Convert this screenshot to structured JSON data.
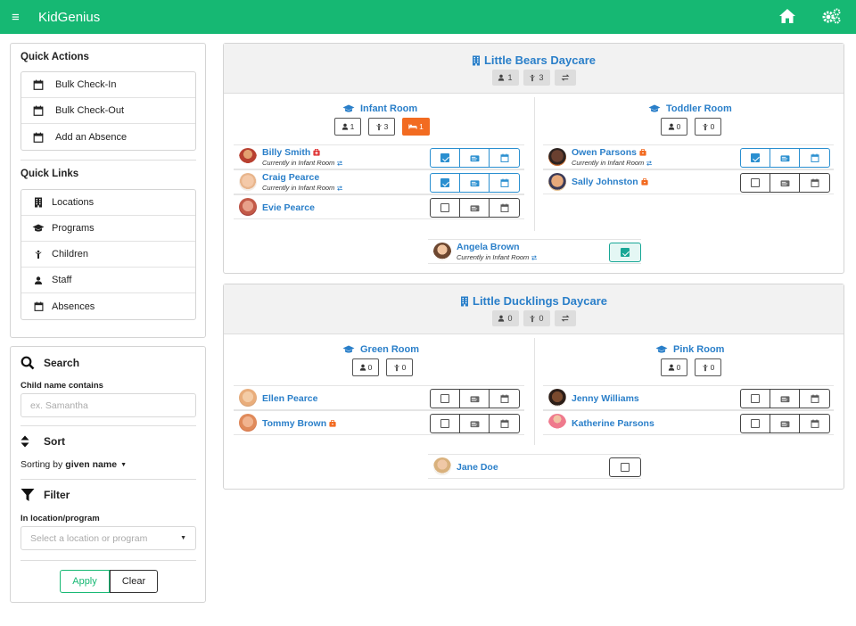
{
  "app": {
    "title": "KidGenius"
  },
  "quick_actions": {
    "title": "Quick Actions",
    "items": [
      {
        "label": "Bulk Check-In",
        "icon": "calendar-check-icon"
      },
      {
        "label": "Bulk Check-Out",
        "icon": "calendar-minus-icon"
      },
      {
        "label": "Add an Absence",
        "icon": "calendar-times-icon"
      }
    ]
  },
  "quick_links": {
    "title": "Quick Links",
    "items": [
      {
        "label": "Locations",
        "icon": "building-icon"
      },
      {
        "label": "Programs",
        "icon": "graduation-cap-icon"
      },
      {
        "label": "Children",
        "icon": "child-icon"
      },
      {
        "label": "Staff",
        "icon": "user-icon"
      },
      {
        "label": "Absences",
        "icon": "calendar-times-icon"
      }
    ]
  },
  "search": {
    "title": "Search",
    "field_label": "Child name contains",
    "placeholder": "ex. Samantha"
  },
  "sort": {
    "title": "Sort",
    "prefix": "Sorting by ",
    "value": "given name"
  },
  "filter": {
    "title": "Filter",
    "field_label": "In location/program",
    "placeholder": "Select a location or program",
    "apply_label": "Apply",
    "clear_label": "Clear"
  },
  "daycares": [
    {
      "name": "Little Bears Daycare",
      "staff_count": "1",
      "children_count": "3",
      "rooms": [
        {
          "name": "Infant Room",
          "staff_count": "1",
          "children_count": "3",
          "absent_count": "1",
          "children": [
            {
              "name": "Billy Smith",
              "status": "Currently in Infant Room"
            },
            {
              "name": "Craig Pearce",
              "status": "Currently in Infant Room"
            },
            {
              "name": "Evie Pearce"
            }
          ]
        },
        {
          "name": "Toddler Room",
          "staff_count": "0",
          "children_count": "0",
          "children": [
            {
              "name": "Owen Parsons",
              "status": "Currently in Infant Room"
            },
            {
              "name": "Sally Johnston"
            }
          ]
        }
      ],
      "staff": [
        {
          "name": "Angela Brown",
          "status": "Currently in Infant Room"
        }
      ]
    },
    {
      "name": "Little Ducklings Daycare",
      "staff_count": "0",
      "children_count": "0",
      "rooms": [
        {
          "name": "Green Room",
          "staff_count": "0",
          "children_count": "0",
          "children": [
            {
              "name": "Ellen Pearce"
            },
            {
              "name": "Tommy Brown"
            }
          ]
        },
        {
          "name": "Pink Room",
          "staff_count": "0",
          "children_count": "0",
          "children": [
            {
              "name": "Jenny Williams"
            },
            {
              "name": "Katherine Parsons"
            }
          ]
        }
      ],
      "staff": [
        {
          "name": "Jane Doe"
        }
      ]
    }
  ],
  "colors": {
    "brand": "#16b873",
    "link": "#2a7fc9",
    "check": "#2a8fd0",
    "absent": "#f26b21",
    "staff_check": "#18a796"
  }
}
